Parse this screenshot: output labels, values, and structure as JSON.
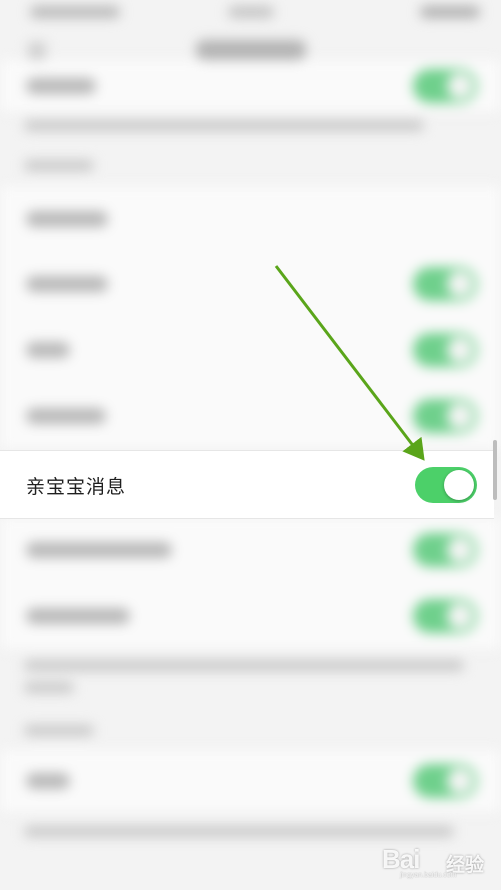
{
  "focus_row": {
    "label": "亲宝宝消息",
    "toggle_on": true
  },
  "colors": {
    "toggle_on": "#4cd069",
    "arrow": "#5aa51a"
  },
  "watermark": {
    "brand": "Bai",
    "brand_suffix": "经验",
    "url": "jingyan.baidu.com"
  }
}
